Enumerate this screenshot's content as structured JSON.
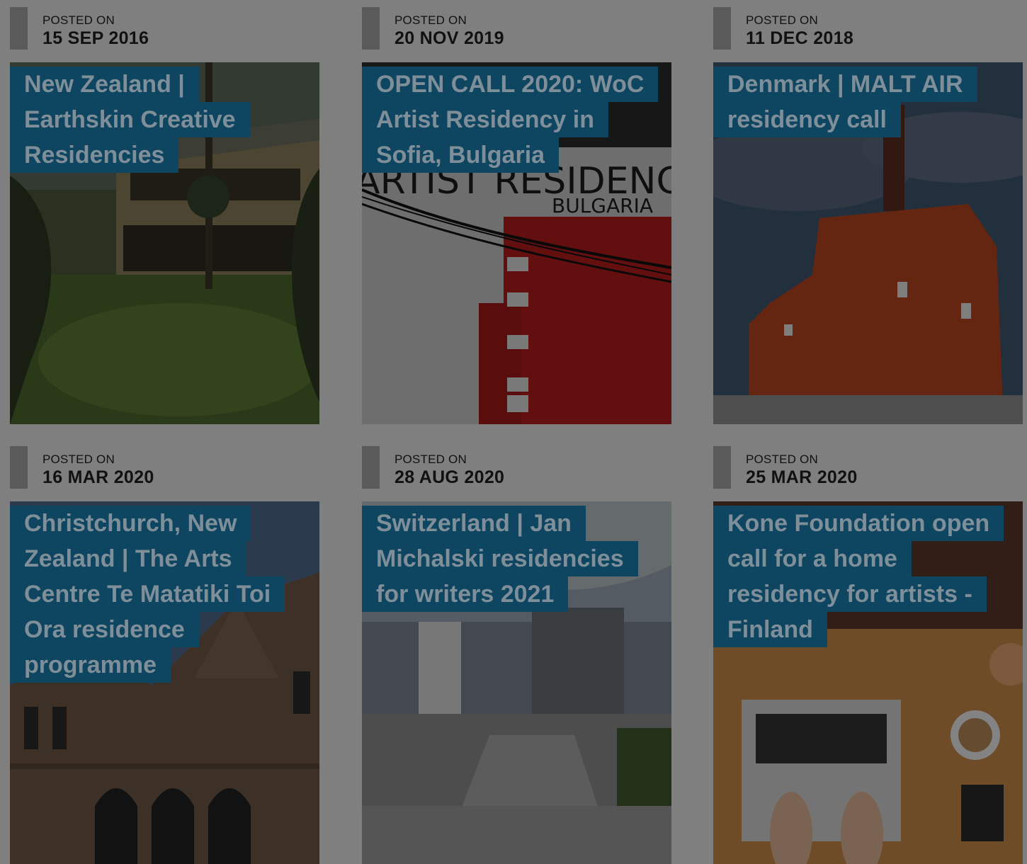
{
  "posts": [
    {
      "label": "POSTED ON",
      "date": "15 SEP 2016",
      "title": "New Zealand | Earthskin Creative Residencies"
    },
    {
      "label": "POSTED ON",
      "date": "20 NOV 2019",
      "title": "OPEN CALL 2020: WoC Artist Residency in Sofia, Bulgaria",
      "image_text_1": "ARTIST RESIDENCY",
      "image_text_2": "BULGARIA"
    },
    {
      "label": "POSTED ON",
      "date": "11 DEC 2018",
      "title": "Denmark | MALT AIR residency call"
    },
    {
      "label": "POSTED ON",
      "date": "16 MAR 2020",
      "title": "Christchurch, New Zealand | The Arts Centre Te Matatiki Toi Ora residence programme"
    },
    {
      "label": "POSTED ON",
      "date": "28 AUG 2020",
      "title": "Switzerland | Jan Michalski residencies for writers 2021"
    },
    {
      "label": "POSTED ON",
      "date": "25 MAR 2020",
      "title": "Kone Foundation open call for a home residency for artists - Finland"
    }
  ],
  "colors": {
    "overlay_gray": "#7f7f7f",
    "title_bg": "#0e4560",
    "title_text": "#7f8f99"
  }
}
